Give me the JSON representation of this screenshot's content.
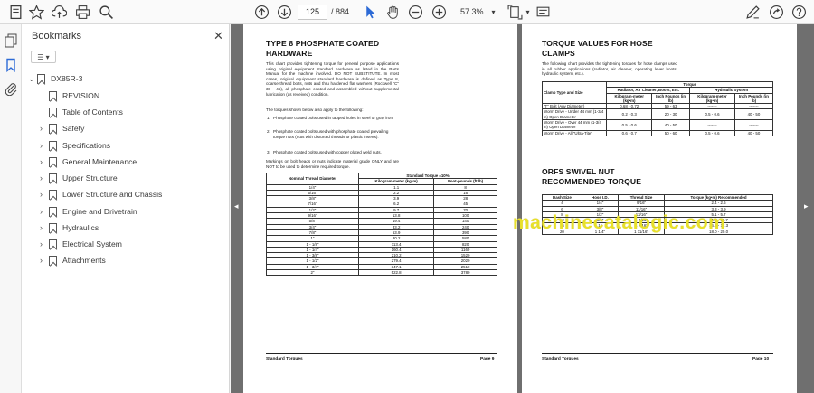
{
  "toolbar": {
    "page_current": "125",
    "page_total": "/ 884",
    "zoom": "57.3%"
  },
  "bookmarks": {
    "title": "Bookmarks",
    "root": "DX85R-3",
    "items": [
      {
        "label": "REVISION",
        "expandable": false
      },
      {
        "label": "Table of Contents",
        "expandable": false
      },
      {
        "label": "Safety",
        "expandable": true
      },
      {
        "label": "Specifications",
        "expandable": true
      },
      {
        "label": "General Maintenance",
        "expandable": true
      },
      {
        "label": "Upper Structure",
        "expandable": true
      },
      {
        "label": "Lower Structure and Chassis",
        "expandable": true
      },
      {
        "label": "Engine and Drivetrain",
        "expandable": true
      },
      {
        "label": "Hydraulics",
        "expandable": true
      },
      {
        "label": "Electrical System",
        "expandable": true
      },
      {
        "label": "Attachments",
        "expandable": true
      }
    ]
  },
  "left_page": {
    "heading_line1": "TYPE 8 PHOSPHATE COATED",
    "heading_line2": "HARDWARE",
    "intro": "This chart provides tightening torque for general purpose applications using original equipment standard hardware as listed in the Parts Manual for the machine involved. DO NOT SUBSTITUTE. In most cases, original equipment standard hardware is defined as Type 8, coarse thread bolts, nuts and thru hardened flat washers (Rockwell \"C\" 38 - 45), all phosphate coated and assembled without supplemental lubrication (as received) condition.",
    "applies": "The torques shown below also apply to the following:",
    "list": [
      {
        "n": "1.",
        "text": "Phosphate coated bolts used in tapped holes in steel or gray iron."
      },
      {
        "n": "2.",
        "text": "Phosphate coated bolts used with phosphate coated prevailing torque nuts (nuts with distorted threads or plastic inserts)."
      },
      {
        "n": "3.",
        "text": "Phosphate coated bolts used with copper plated weld nuts."
      }
    ],
    "markings": "Markings on bolt heads or nuts indicate material grade ONLY and are NOT to be used to determine required torque.",
    "table": {
      "col1": "Nominal Thread Diameter",
      "group": "Standard Torque ±10%",
      "col2": "Kilogram-meter (kg•m)",
      "col3": "Foot-pounds (ft lb)",
      "rows": [
        [
          "1/4\"",
          "1.1",
          "8"
        ],
        [
          "5/16\"",
          "2.2",
          "16"
        ],
        [
          "3/8\"",
          "3.9",
          "28"
        ],
        [
          "7/16\"",
          "6.2",
          "45"
        ],
        [
          "1/2\"",
          "9.7",
          "70"
        ],
        [
          "9/16\"",
          "13.8",
          "100"
        ],
        [
          "5/8\"",
          "19.4",
          "140"
        ],
        [
          "3/4\"",
          "33.2",
          "240"
        ],
        [
          "7/8\"",
          "53.9",
          "390"
        ],
        [
          "1\"",
          "80.2",
          "580"
        ],
        [
          "1 - 1/8\"",
          "113.4",
          "820"
        ],
        [
          "1 - 1/4\"",
          "160.4",
          "1160"
        ],
        [
          "1 - 3/8\"",
          "210.2",
          "1520"
        ],
        [
          "1 - 1/2\"",
          "279.4",
          "2020"
        ],
        [
          "1 - 3/4\"",
          "347.1",
          "2510"
        ],
        [
          "2\"",
          "522.8",
          "3780"
        ]
      ]
    },
    "footer_left": "Standard Torques",
    "footer_right": "Page 9"
  },
  "right_page": {
    "heading1_line1": "TORQUE VALUES FOR HOSE",
    "heading1_line2": "CLAMPS",
    "intro": "The following chart provides the tightening torques for hose clamps used in all rubber applications (radiator, air cleaner, operating lever boots, hydraulic system, etc.).",
    "clamp_table": {
      "torque": "Torque",
      "col_type": "Clamp Type and Size",
      "group1": "Radiator, Air Cleaner, Boots, Etc.",
      "group2": "Hydraulic System",
      "sub": [
        "Kilogram-meter (kg•m)",
        "Inch Pounds (in lb)",
        "Kilogram-meter (kg•m)",
        "Inch Pounds (in lb)"
      ],
      "rows": [
        [
          "\"T\" Bolt (Any Diameter)",
          "0.68 - 0.72",
          "59 - 63",
          "-------",
          "-------"
        ],
        [
          "Worm Drive - Under 44 mm (1-3/4 in) Open Diameter",
          "0.2 - 0.3",
          "20 - 30",
          "0.5 - 0.6",
          "40 - 50"
        ],
        [
          "Worm Drive - Over 44 mm (1-3/4 in) Open Diameter",
          "0.5 - 0.6",
          "40 - 50",
          "-------",
          "-------"
        ],
        [
          "Worm Drive - All \"Ultra-Tite\"",
          "0.6 - 0.7",
          "50 - 60",
          "0.5 - 0.6",
          "40 - 50"
        ]
      ]
    },
    "heading2_line1": "ORFS SWIVEL NUT",
    "heading2_line2": "RECOMMENDED TORQUE",
    "orfs_table": {
      "headers": [
        "Dash Size",
        "Hose I.D.",
        "Thread Size",
        "Torque (kg•m) Recommended"
      ],
      "rows": [
        [
          "4",
          "1/4\"",
          "9/16\"",
          "2.4 - 2.6"
        ],
        [
          "6",
          "3/8\"",
          "11/16\"",
          "3.3 - 3.9"
        ],
        [
          "8",
          "1/2\"",
          "13/16\"",
          "5.1 - 5.7"
        ],
        [
          "12",
          "3/4\"",
          "1 3/16\"",
          "11.7 - 12.7"
        ],
        [
          "16",
          "1\"",
          "1 7/16\"",
          "16.3 - 17.3"
        ],
        [
          "20",
          "1 1/4\"",
          "1 11/16\"",
          "18.0 - 20.0"
        ]
      ]
    },
    "footer_left": "Standard Torques",
    "footer_right": "Page 10"
  },
  "watermark": "machinecatalogic.com"
}
